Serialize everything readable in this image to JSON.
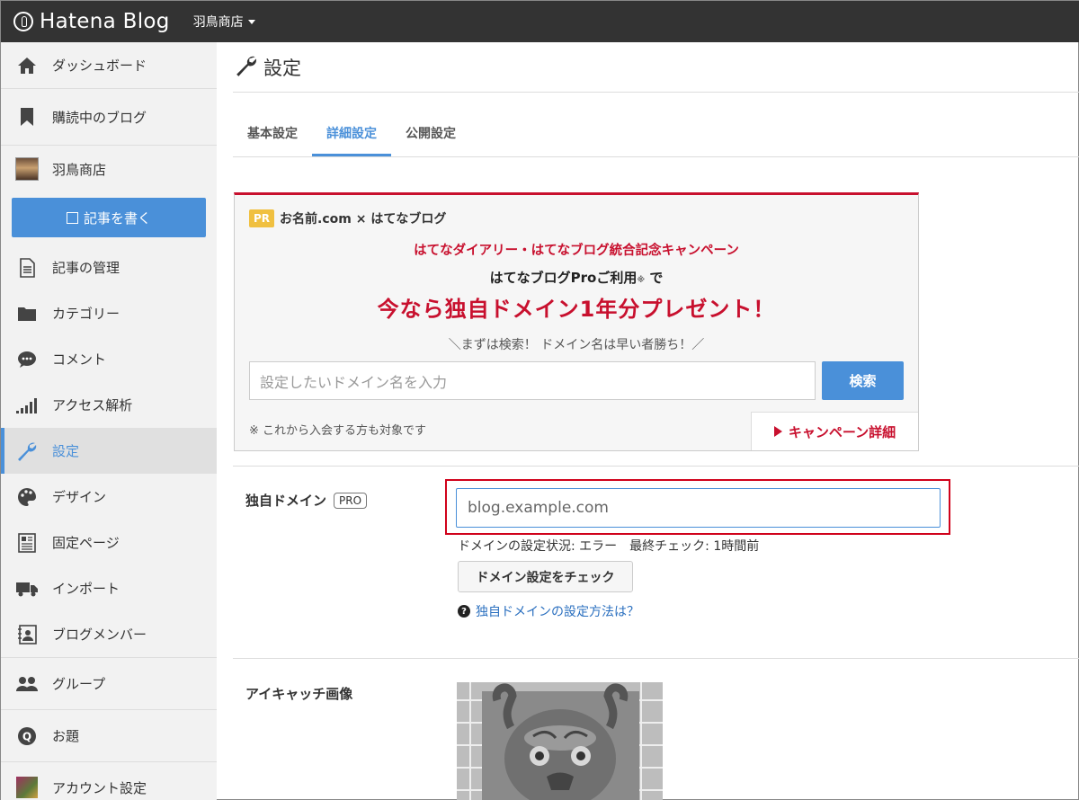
{
  "topbar": {
    "brand": "Hatena Blog",
    "blog_name": "羽鳥商店"
  },
  "sidebar": {
    "items": [
      {
        "label": "ダッシュボード",
        "icon": "home-icon"
      },
      {
        "label": "購読中のブログ",
        "icon": "bookmark-icon"
      },
      {
        "label": "羽鳥商店",
        "icon": "blog-avatar"
      },
      {
        "label": "記事の管理",
        "icon": "document-icon"
      },
      {
        "label": "カテゴリー",
        "icon": "folder-icon"
      },
      {
        "label": "コメント",
        "icon": "comment-icon"
      },
      {
        "label": "アクセス解析",
        "icon": "bar-chart-icon"
      },
      {
        "label": "設定",
        "icon": "wrench-icon"
      },
      {
        "label": "デザイン",
        "icon": "palette-icon"
      },
      {
        "label": "固定ページ",
        "icon": "page-icon"
      },
      {
        "label": "インポート",
        "icon": "truck-icon"
      },
      {
        "label": "ブログメンバー",
        "icon": "member-icon"
      },
      {
        "label": "グループ",
        "icon": "group-icon"
      },
      {
        "label": "お題",
        "icon": "q-icon"
      },
      {
        "label": "アカウント設定",
        "icon": "account-avatar"
      }
    ],
    "write_button": "記事を書く"
  },
  "page": {
    "title": "設定"
  },
  "tabs": [
    {
      "label": "基本設定"
    },
    {
      "label": "詳細設定"
    },
    {
      "label": "公開設定"
    }
  ],
  "pr": {
    "badge": "PR",
    "heading": "お名前.com × はてなブログ",
    "line1": "はてなダイアリー・はてなブログ統合記念キャンペーン",
    "line2": "はてなブログProご利用",
    "line2_note": "※",
    "line2_suffix": " で",
    "line3": "今なら独自ドメイン1年分プレゼント！",
    "line4": "＼まずは検索！ ドメイン名は早い者勝ち！／",
    "search_placeholder": "設定したいドメイン名を入力",
    "search_button": "検索",
    "note": "※ これから入会する方も対象です",
    "detail_link": "キャンペーン詳細"
  },
  "domain": {
    "label": "独自ドメイン",
    "pro_tag": "PRO",
    "value": "blog.example.com",
    "status": "ドメインの設定状況: エラー　最終チェック: 1時間前",
    "check_button": "ドメイン設定をチェック",
    "help_link": "独自ドメインの設定方法は？"
  },
  "eyecatch": {
    "label": "アイキャッチ画像"
  },
  "colors": {
    "accent": "#4a90d9",
    "campaign_red": "#c8102e",
    "topbar": "#333333"
  }
}
